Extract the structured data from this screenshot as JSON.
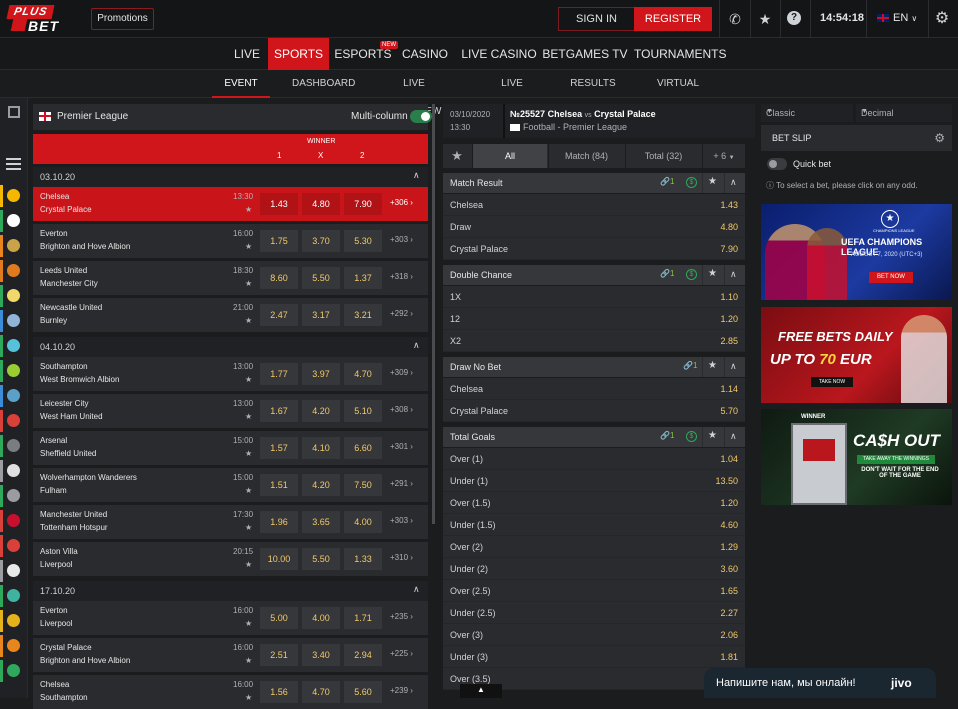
{
  "topbar": {
    "logo": {
      "top": "PLUS",
      "bottom": "BET"
    },
    "promotions": "Promotions",
    "sign_in": "SIGN IN",
    "register": "REGISTER",
    "time": "14:54:18",
    "language": "EN"
  },
  "nav": {
    "items": [
      {
        "label": "LIVE"
      },
      {
        "label": "SPORTS"
      },
      {
        "label": "ESPORTS",
        "badge": "NEW"
      },
      {
        "label": "CASINO"
      },
      {
        "label": "LIVE CASINO"
      },
      {
        "label": "BETGAMES TV"
      },
      {
        "label": "TOURNAMENTS"
      }
    ]
  },
  "subnav": {
    "items": [
      "EVENT VIEW",
      "DASHBOARD",
      "LIVE MULTIVIEW",
      "LIVE CALENDAR",
      "RESULTS",
      "VIRTUAL SPORTS"
    ]
  },
  "left_panel": {
    "league": "Premier League",
    "multi_column": "Multi-column",
    "winner": "WINNER",
    "cols": [
      "1",
      "X",
      "2"
    ],
    "groups": [
      {
        "date": "03.10.20",
        "events": [
          {
            "home": "Chelsea",
            "away": "Crystal Palace",
            "time": "13:30",
            "o1": "1.43",
            "ox": "4.80",
            "o2": "7.90",
            "more": "+306"
          },
          {
            "home": "Everton",
            "away": "Brighton and Hove Albion",
            "time": "16:00",
            "o1": "1.75",
            "ox": "3.70",
            "o2": "5.30",
            "more": "+303"
          },
          {
            "home": "Leeds United",
            "away": "Manchester City",
            "time": "18:30",
            "o1": "8.60",
            "ox": "5.50",
            "o2": "1.37",
            "more": "+318"
          },
          {
            "home": "Newcastle United",
            "away": "Burnley",
            "time": "21:00",
            "o1": "2.47",
            "ox": "3.17",
            "o2": "3.21",
            "more": "+292"
          }
        ]
      },
      {
        "date": "04.10.20",
        "events": [
          {
            "home": "Southampton",
            "away": "West Bromwich Albion",
            "time": "13:00",
            "o1": "1.77",
            "ox": "3.97",
            "o2": "4.70",
            "more": "+309"
          },
          {
            "home": "Leicester City",
            "away": "West Ham United",
            "time": "13:00",
            "o1": "1.67",
            "ox": "4.20",
            "o2": "5.10",
            "more": "+308"
          },
          {
            "home": "Arsenal",
            "away": "Sheffield United",
            "time": "15:00",
            "o1": "1.57",
            "ox": "4.10",
            "o2": "6.60",
            "more": "+301"
          },
          {
            "home": "Wolverhampton Wanderers",
            "away": "Fulham",
            "time": "15:00",
            "o1": "1.51",
            "ox": "4.20",
            "o2": "7.50",
            "more": "+291"
          },
          {
            "home": "Manchester United",
            "away": "Tottenham Hotspur",
            "time": "17:30",
            "o1": "1.96",
            "ox": "3.65",
            "o2": "4.00",
            "more": "+303"
          },
          {
            "home": "Aston Villa",
            "away": "Liverpool",
            "time": "20:15",
            "o1": "10.00",
            "ox": "5.50",
            "o2": "1.33",
            "more": "+310"
          }
        ]
      },
      {
        "date": "17.10.20",
        "events": [
          {
            "home": "Everton",
            "away": "Liverpool",
            "time": "16:00",
            "o1": "5.00",
            "ox": "4.00",
            "o2": "1.71",
            "more": "+235"
          },
          {
            "home": "Crystal Palace",
            "away": "Brighton and Hove Albion",
            "time": "16:00",
            "o1": "2.51",
            "ox": "3.40",
            "o2": "2.94",
            "more": "+225"
          },
          {
            "home": "Chelsea",
            "away": "Southampton",
            "time": "16:00",
            "o1": "1.56",
            "ox": "4.70",
            "o2": "5.60",
            "more": "+239"
          }
        ]
      }
    ]
  },
  "match": {
    "date": "03/10/2020",
    "time": "13:30",
    "id": "№25527",
    "home": "Chelsea",
    "vs": "vs",
    "away": "Crystal Palace",
    "sport": "Football - Premier League",
    "tabs": [
      "All",
      "Match (84)",
      "Total (32)",
      "+ 6"
    ],
    "markets": [
      {
        "name": "Match Result",
        "links": "1",
        "selections": [
          {
            "name": "Chelsea",
            "odd": "1.43"
          },
          {
            "name": "Draw",
            "odd": "4.80"
          },
          {
            "name": "Crystal Palace",
            "odd": "7.90"
          }
        ]
      },
      {
        "name": "Double Chance",
        "links": "1",
        "selections": [
          {
            "name": "1X",
            "odd": "1.10"
          },
          {
            "name": "12",
            "odd": "1.20"
          },
          {
            "name": "X2",
            "odd": "2.85"
          }
        ]
      },
      {
        "name": "Draw No Bet",
        "links": "1",
        "selections": [
          {
            "name": "Chelsea",
            "odd": "1.14"
          },
          {
            "name": "Crystal Palace",
            "odd": "5.70"
          }
        ]
      },
      {
        "name": "Total Goals",
        "links": "1",
        "selections": [
          {
            "name": "Over (1)",
            "odd": "1.04"
          },
          {
            "name": "Under (1)",
            "odd": "13.50"
          },
          {
            "name": "Over (1.5)",
            "odd": "1.20"
          },
          {
            "name": "Under (1.5)",
            "odd": "4.60"
          },
          {
            "name": "Over (2)",
            "odd": "1.29"
          },
          {
            "name": "Under (2)",
            "odd": "3.60"
          },
          {
            "name": "Over (2.5)",
            "odd": "1.65"
          },
          {
            "name": "Under (2.5)",
            "odd": "2.27"
          },
          {
            "name": "Over (3)",
            "odd": "2.06"
          },
          {
            "name": "Under (3)",
            "odd": "1.81"
          },
          {
            "name": "Over (3.5)",
            "odd": ""
          }
        ]
      }
    ]
  },
  "right_panel": {
    "odds_type": "Classic",
    "odds_format": "Decimal",
    "bet_slip": "BET SLIP",
    "quick_bet": "Quick bet",
    "hint": "To select a bet, please click on any odd.",
    "banners": {
      "ucl": {
        "title": "UEFA CHAMPIONS LEAGUE",
        "date": "AUGUST 7, 2020 (UTC+3)",
        "button": "BET NOW",
        "brand": "CHAMPIONS LEAGUE"
      },
      "free": {
        "line1": "FREE BETS DAILY",
        "line2a": "UP TO",
        "amount": "70",
        "line2b": "EUR",
        "button": "TAKE NOW"
      },
      "cash": {
        "brand": "WINNER",
        "title": "CA$H OUT",
        "sub": "TAKE AWAY THE WINNINGS",
        "note": "DON'T WAIT FOR THE END OF THE GAME"
      }
    }
  },
  "chat": {
    "text": "Напишите нам, мы онлайн!",
    "brand": "jivo"
  },
  "colors": {
    "accent": "#d0161b",
    "odds": "#f3c96a",
    "panel": "#2a2b2e",
    "bg": "#1b1c1e"
  }
}
